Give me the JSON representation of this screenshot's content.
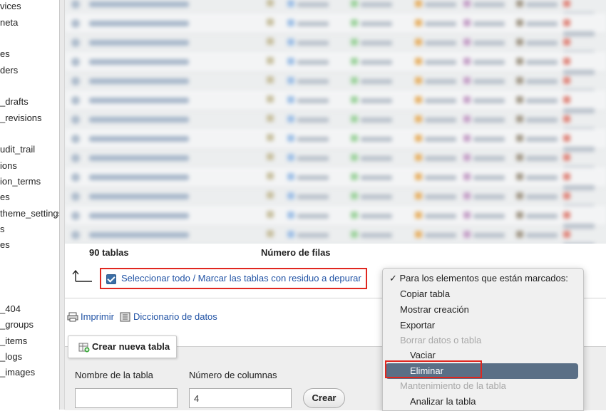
{
  "sidebar": {
    "items": [
      {
        "label": "vices"
      },
      {
        "label": "neta"
      },
      {
        "label": "es"
      },
      {
        "label": "ders"
      },
      {
        "label": "_drafts"
      },
      {
        "label": "_revisions"
      },
      {
        "label": "udit_trail"
      },
      {
        "label": "ions"
      },
      {
        "label": "ion_terms"
      },
      {
        "label": "es"
      },
      {
        "label": "theme_settings"
      },
      {
        "label": "s"
      },
      {
        "label": "es"
      },
      {
        "label": "_404"
      },
      {
        "label": "_groups"
      },
      {
        "label": "_items"
      },
      {
        "label": "_logs"
      },
      {
        "label": "_images"
      }
    ]
  },
  "table_footer": {
    "table_count": "90 tablas",
    "rows_header": "Número de filas"
  },
  "select_all": {
    "label": "Seleccionar todo / Marcar las tablas con residuo a depurar",
    "checked": true
  },
  "links": {
    "print": "Imprimir",
    "data_dictionary": "Diccionario de datos"
  },
  "create_table": {
    "legend": "Crear nueva tabla",
    "name_label": "Nombre de la tabla",
    "columns_label": "Número de columnas",
    "name_value": "",
    "columns_value": "4",
    "create_button": "Crear"
  },
  "dropdown": {
    "options": [
      {
        "label": "✓ Para los elementos que están marcados:",
        "kind": "option"
      },
      {
        "label": "Copiar tabla",
        "kind": "option"
      },
      {
        "label": "Mostrar creación",
        "kind": "option"
      },
      {
        "label": "Exportar",
        "kind": "option"
      },
      {
        "label": "Borrar datos o tabla",
        "kind": "group"
      },
      {
        "label": "Vaciar",
        "kind": "child"
      },
      {
        "label": "Eliminar",
        "kind": "child",
        "highlighted": true
      },
      {
        "label": "Mantenimiento de la tabla",
        "kind": "group"
      },
      {
        "label": "Analizar la tabla",
        "kind": "child"
      }
    ]
  },
  "colors": {
    "link": "#2153a5",
    "highlight_border": "#e0271f",
    "menu_highlight": "#5a6f86"
  }
}
